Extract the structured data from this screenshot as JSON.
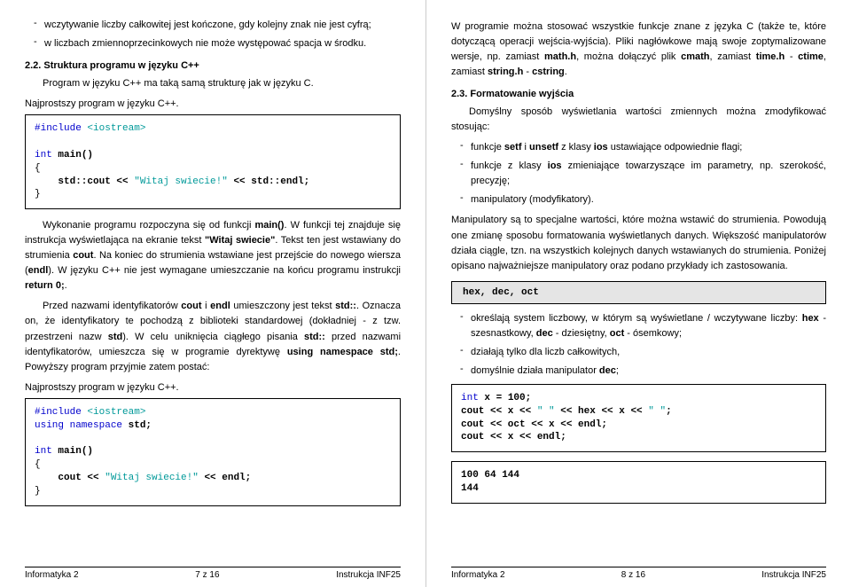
{
  "left": {
    "bullets_top": [
      "wczytywanie liczby całkowitej jest kończone, gdy kolejny znak nie jest cyfrą;",
      "w liczbach zmiennoprzecinkowych nie może występować spacja w środku."
    ],
    "h22_num": "2.2.",
    "h22_title": "Struktura programu w języku C++",
    "p1": "Program w języku C++ ma taką samą strukturę jak w języku C.",
    "cap1": "Najprostszy program w języku C++.",
    "code1_l1a": "#include",
    "code1_l1b": "<iostream>",
    "code1_l2a": "int",
    "code1_l2b": " main()",
    "code1_l3": "{",
    "code1_l4a": "    std::cout << ",
    "code1_l4b": "\"Witaj swiecie!\"",
    "code1_l4c": " << std::endl;",
    "code1_l5": "}",
    "p2_a": "Wykonanie programu rozpoczyna się od funkcji ",
    "p2_b": "main()",
    "p2_c": ". W funkcji tej znajduje się instrukcja wyświetlająca na ekranie tekst ",
    "p2_d": "\"Witaj swiecie\"",
    "p2_e": ". Tekst ten jest wstawiany do strumienia ",
    "p2_f": "cout",
    "p2_g": ". Na koniec do strumienia wstawiane jest przejście do nowego wiersza (",
    "p2_h": "endl",
    "p2_i": "). W języku C++ nie jest wymagane umieszczanie na końcu programu instrukcji ",
    "p2_j": "return 0;",
    "p2_k": ".",
    "p3_a": "Przed nazwami identyfikatorów ",
    "p3_b": "cout",
    "p3_c": " i ",
    "p3_d": "endl",
    "p3_e": " umieszczony jest tekst ",
    "p3_f": "std::",
    "p3_g": ". Oznacza on, że identyfikatory te pochodzą z biblioteki standardowej (dokładniej - z tzw. przestrzeni nazw ",
    "p3_h": "std",
    "p3_i": "). W celu uniknięcia ciągłego pisania ",
    "p3_j": "std::",
    "p3_k": " przed nazwami identyfikatorów, umieszcza się w programie dyrektywę ",
    "p3_l": "using namespace std;",
    "p3_m": ". Powyższy program przyjmie zatem postać:",
    "cap2": "Najprostszy program w języku C++.",
    "code2_l1a": "#include",
    "code2_l1b": "<iostream>",
    "code2_l2a": "using namespace",
    "code2_l2b": " std;",
    "code2_l3a": "int",
    "code2_l3b": " main()",
    "code2_l4": "{",
    "code2_l5a": "    cout << ",
    "code2_l5b": "\"Witaj swiecie!\"",
    "code2_l5c": " << endl;",
    "code2_l6": "}",
    "footer_l": "Informatyka 2",
    "footer_c": "7 z 16",
    "footer_r": "Instrukcja INF25"
  },
  "right": {
    "p1_a": "W programie można stosować wszystkie funkcje znane z języka C (także te, które dotyczącą operacji wejścia-wyjścia). Pliki nagłówkowe mają swoje zoptymalizowane wersje, np. zamiast ",
    "p1_b": "math.h",
    "p1_c": ", można dołączyć plik ",
    "p1_d": "cmath",
    "p1_e": ", zamiast ",
    "p1_f": "time.h",
    "p1_g": " - ",
    "p1_h": "ctime",
    "p1_i": ", zamiast ",
    "p1_j": "string.h",
    "p1_k": " - ",
    "p1_l": "cstring",
    "p1_m": ".",
    "h23_num": "2.3.",
    "h23_title": "Formatowanie wyjścia",
    "p2": "Domyślny sposób wyświetlania wartości zmiennych można zmodyfikować stosując:",
    "b1_a": "funkcje ",
    "b1_b": "setf",
    "b1_c": " i ",
    "b1_d": "unsetf",
    "b1_e": " z klasy ",
    "b1_f": "ios",
    "b1_g": " ustawiające odpowiednie flagi;",
    "b2_a": "funkcje z klasy ",
    "b2_b": "ios",
    "b2_c": " zmieniające towarzyszące im parametry, np. szerokość, precyzję;",
    "b3": "manipulatory (modyfikatory).",
    "p3": "Manipulatory są to specjalne wartości, które można wstawić do strumienia. Powodują one zmianę sposobu formatowania wyświetlanych danych. Większość manipulatorów działa ciągle, tzn. na wszystkich kolejnych danych wstawianych do strumienia. Poniżej opisano najważniejsze manipulatory oraz podano przykłady ich zastosowania.",
    "box1": "hex, dec, oct",
    "b4_a": "określają system liczbowy, w którym są wyświetlane / wczytywane liczby: ",
    "b4_b": "hex",
    "b4_c": " - szesnastkowy, ",
    "b4_d": "dec",
    "b4_e": " - dziesiętny, ",
    "b4_f": "oct",
    "b4_g": " - ósemkowy;",
    "b5": "działają tylko dla liczb całkowitych,",
    "b6_a": "domyślnie działa manipulator ",
    "b6_b": "dec",
    "b6_c": ";",
    "code1_l1a": "int",
    "code1_l1b": " x = 100;",
    "code1_l2a": "cout << x << ",
    "code1_l2b": "\" \"",
    "code1_l2c": " << hex << x << ",
    "code1_l2d": "\" \"",
    "code1_l2e": ";",
    "code1_l3": "cout << oct << x << endl;",
    "code1_l4": "cout << x << endl;",
    "code2_l1": "100 64 144",
    "code2_l2": "144",
    "footer_l": "Informatyka 2",
    "footer_c": "8 z 16",
    "footer_r": "Instrukcja INF25"
  }
}
